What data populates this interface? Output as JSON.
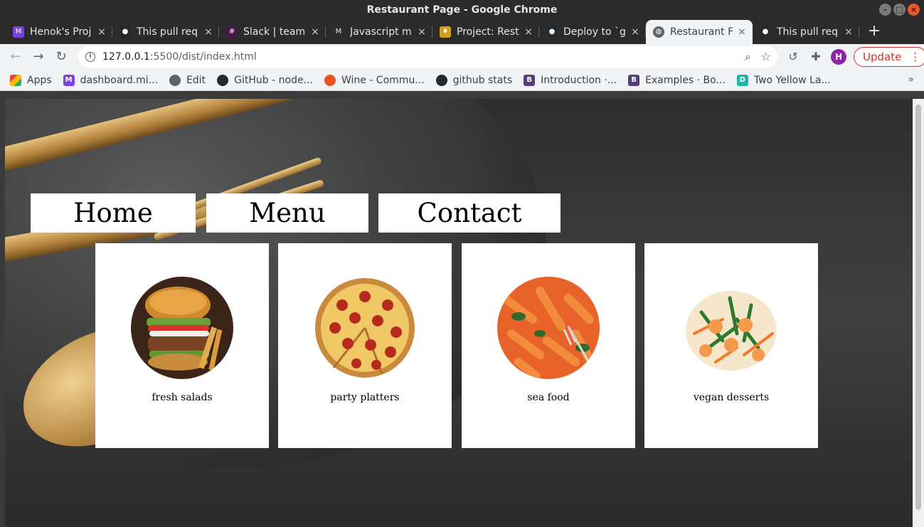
{
  "window": {
    "title": "Restaurant Page - Google Chrome"
  },
  "tabs": [
    {
      "title": "Henok's Proj",
      "icon": "microverse-icon",
      "color": "#7b3fe4"
    },
    {
      "title": "This pull req",
      "icon": "github-icon",
      "color": "#24292e"
    },
    {
      "title": "Slack | team-",
      "icon": "slack-icon",
      "color": "#4a154b"
    },
    {
      "title": "Javascript m",
      "icon": "microverse-icon",
      "color": "#7b3fe4"
    },
    {
      "title": "Project: Rest",
      "icon": "odin-icon",
      "color": "#d4a017"
    },
    {
      "title": "Deploy to `g",
      "icon": "github-icon",
      "color": "#24292e"
    },
    {
      "title": "Restaurant F",
      "icon": "globe-icon",
      "color": "#5f6368",
      "active": true
    },
    {
      "title": "This pull req",
      "icon": "github-icon",
      "color": "#24292e"
    }
  ],
  "toolbar": {
    "url_host": "127.0.0.1",
    "url_rest": ":5500/dist/index.html",
    "avatar_letter": "H",
    "update_label": "Update"
  },
  "bookmarks": [
    {
      "label": "Apps",
      "icon": "apps-grid-icon",
      "color": "#e94235"
    },
    {
      "label": "dashboard.mi...",
      "icon": "microverse-icon",
      "color": "#7b3fe4"
    },
    {
      "label": "Edit",
      "icon": "globe-icon",
      "color": "#5f6368"
    },
    {
      "label": "GitHub - node...",
      "icon": "github-icon",
      "color": "#24292e"
    },
    {
      "label": "Wine - Commu...",
      "icon": "ubuntu-icon",
      "color": "#e95420"
    },
    {
      "label": "github stats",
      "icon": "github-icon",
      "color": "#24292e"
    },
    {
      "label": "Introduction ·...",
      "icon": "bootstrap-icon",
      "color": "#563d7c"
    },
    {
      "label": "Examples · Bo...",
      "icon": "bootstrap-icon",
      "color": "#563d7c"
    },
    {
      "label": "Two Yellow La...",
      "icon": "d-icon",
      "color": "#1cb5a3"
    }
  ],
  "page": {
    "nav": [
      "Home",
      "Menu",
      "Contact"
    ],
    "cards": [
      {
        "label": "fresh salads",
        "image": "burger-image"
      },
      {
        "label": "party platters",
        "image": "pizza-image"
      },
      {
        "label": "sea food",
        "image": "pasta-image"
      },
      {
        "label": "vegan desserts",
        "image": "shrimp-salad-image"
      }
    ]
  }
}
